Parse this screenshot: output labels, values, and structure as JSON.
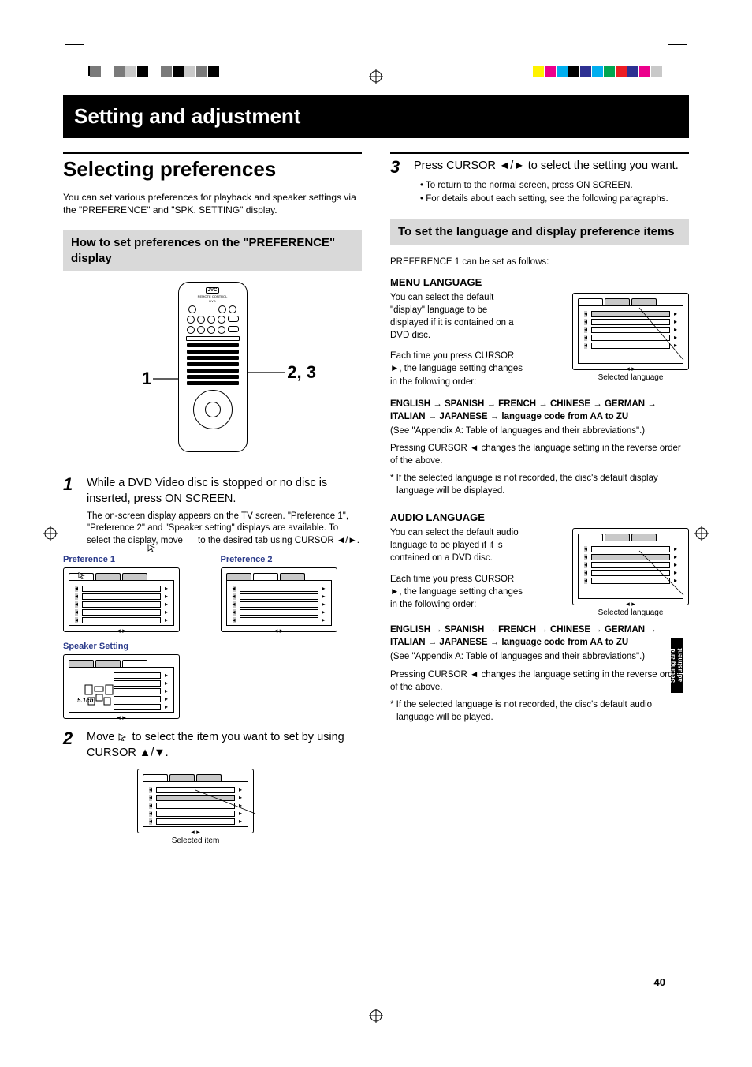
{
  "banner": "Setting and adjustment",
  "section_title": "Selecting preferences",
  "intro": "You can set various preferences for playback and speaker settings via the \"PREFERENCE\" and \"SPK. SETTING\" display.",
  "subhead_left": "How to set preferences on the \"PREFERENCE\" display",
  "callout_left": "1",
  "callout_right": "2, 3",
  "step1": {
    "num": "1",
    "title": "While a DVD Video disc is stopped or no disc is inserted, press ON SCREEN.",
    "body": "The on-screen display appears on the TV screen. \"Preference 1\", \"Preference 2\" and \"Speaker setting\" displays are available. To select the display, move      to the desired tab using CURSOR ◄/►."
  },
  "pref1_label": "Preference 1",
  "pref2_label": "Preference 2",
  "spk_label": "Speaker Setting",
  "spk_ch": "5.1ch",
  "step2": {
    "num": "2",
    "title_a": "Move ",
    "title_b": " to select the item you want to set by using CURSOR ▲/▼."
  },
  "caption_selected_item": "Selected item",
  "step3": {
    "num": "3",
    "title": "Press CURSOR ◄/► to select the setting you want.",
    "b1": "To return to the normal screen, press ON SCREEN.",
    "b2": "For details about each setting, see the following paragraphs."
  },
  "subhead_right": "To set the language and display preference items",
  "pref1_note": "PREFERENCE 1 can be set as follows:",
  "menu_lang": {
    "head": "MENU LANGUAGE",
    "p1": "You can select the default \"display\" language to be displayed if it is contained on a DVD disc.",
    "p2": "Each time you press CURSOR ►, the language setting changes in the following order:",
    "caption": "Selected language",
    "seq": "ENGLISH → SPANISH → FRENCH → CHINESE → GERMAN → ITALIAN → JAPANESE → language code from AA to ZU",
    "see": "(See \"Appendix A: Table of languages and their abbreviations\".)",
    "rev": "Pressing CURSOR ◄ changes the language setting in the reverse order of the above.",
    "star": "* If the selected language is not recorded, the disc's default display language will be displayed."
  },
  "audio_lang": {
    "head": "AUDIO LANGUAGE",
    "p1": "You can select the default audio language to be played if it is contained on a DVD disc.",
    "p2": "Each time you press CURSOR ►, the language setting changes in the following order:",
    "caption": "Selected language",
    "seq": "ENGLISH → SPANISH → FRENCH → CHINESE → GERMAN → ITALIAN → JAPANESE → language code from AA to ZU",
    "see": "(See \"Appendix A: Table of languages and their abbreviations\".)",
    "rev": "Pressing CURSOR ◄ changes the language setting in the reverse order of the above.",
    "star": "* If the selected language is not recorded, the disc's default audio language will be played."
  },
  "side_tab": "Setting and adjustment",
  "page_number": "40",
  "remote_brand": "JVC",
  "remote_sub": "REMOTE CONTROL",
  "remote_dvd": "DVD"
}
